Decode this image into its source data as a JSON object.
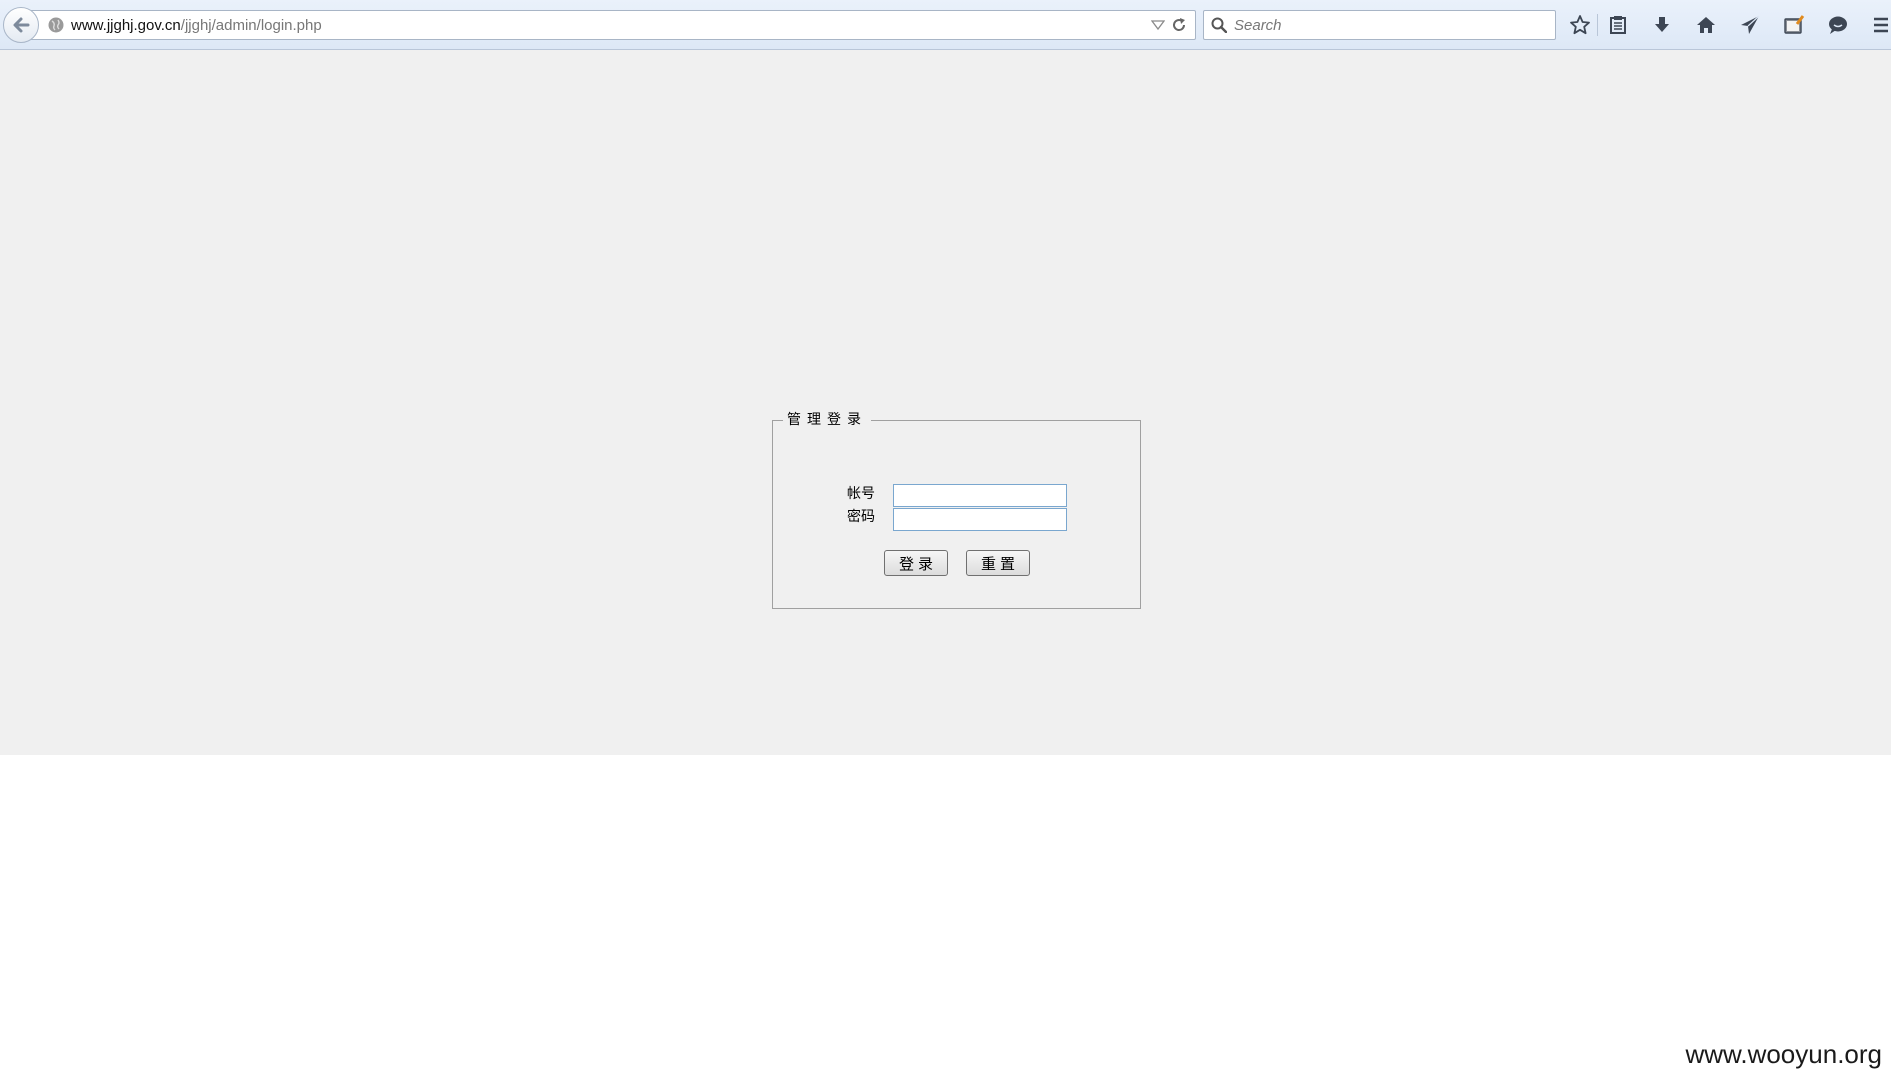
{
  "browser": {
    "url_host": "www.jjghj.gov.cn",
    "url_path": "/jjghj/admin/login.php",
    "search_placeholder": "Search"
  },
  "login": {
    "legend": "管理登录",
    "account_label": "帐号",
    "password_label": "密码",
    "account_value": "",
    "password_value": "",
    "submit_label": "登录",
    "reset_label": "重置"
  },
  "watermark": "www.wooyun.org",
  "colors": {
    "page_background": "#f0f0f0",
    "input_border": "#7aa7cf",
    "fieldset_border": "#a0a0a0"
  },
  "icons": {
    "toolbar": [
      "star-icon",
      "reading-list-icon",
      "download-icon",
      "home-icon",
      "send-icon",
      "screenshot-icon",
      "chat-icon",
      "menu-icon"
    ]
  }
}
